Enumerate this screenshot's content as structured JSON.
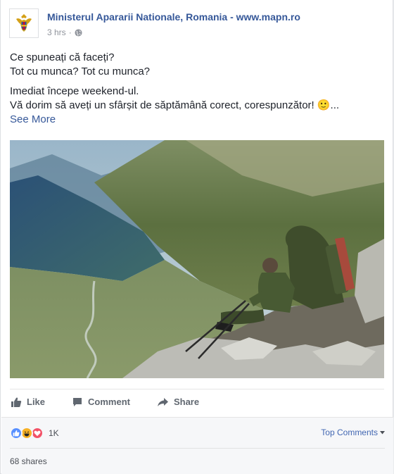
{
  "post": {
    "page_name": "Ministerul Apararii Nationale, Romania - www.mapn.ro",
    "time": "3 hrs",
    "privacy_dot": "·",
    "text_lines": [
      "Ce spuneați că faceți?",
      "Tot cu munca? Tot cu munca?",
      "Imediat începe weekend-ul.",
      "Vă dorim să aveți un sfârșit de săptămână corect, corespunzător! 🙂..."
    ],
    "see_more": "See More"
  },
  "actions": {
    "like": "Like",
    "comment": "Comment",
    "share": "Share"
  },
  "footer": {
    "reaction_count": "1K",
    "reaction_icons": [
      "like-icon",
      "haha-icon",
      "love-icon"
    ],
    "top_comments": "Top Comments",
    "shares": "68 shares"
  },
  "colors": {
    "link": "#365899",
    "muted": "#90949c",
    "like_blue": "#5890ff",
    "love_red": "#f25268",
    "haha_yellow": "#f7b125"
  }
}
